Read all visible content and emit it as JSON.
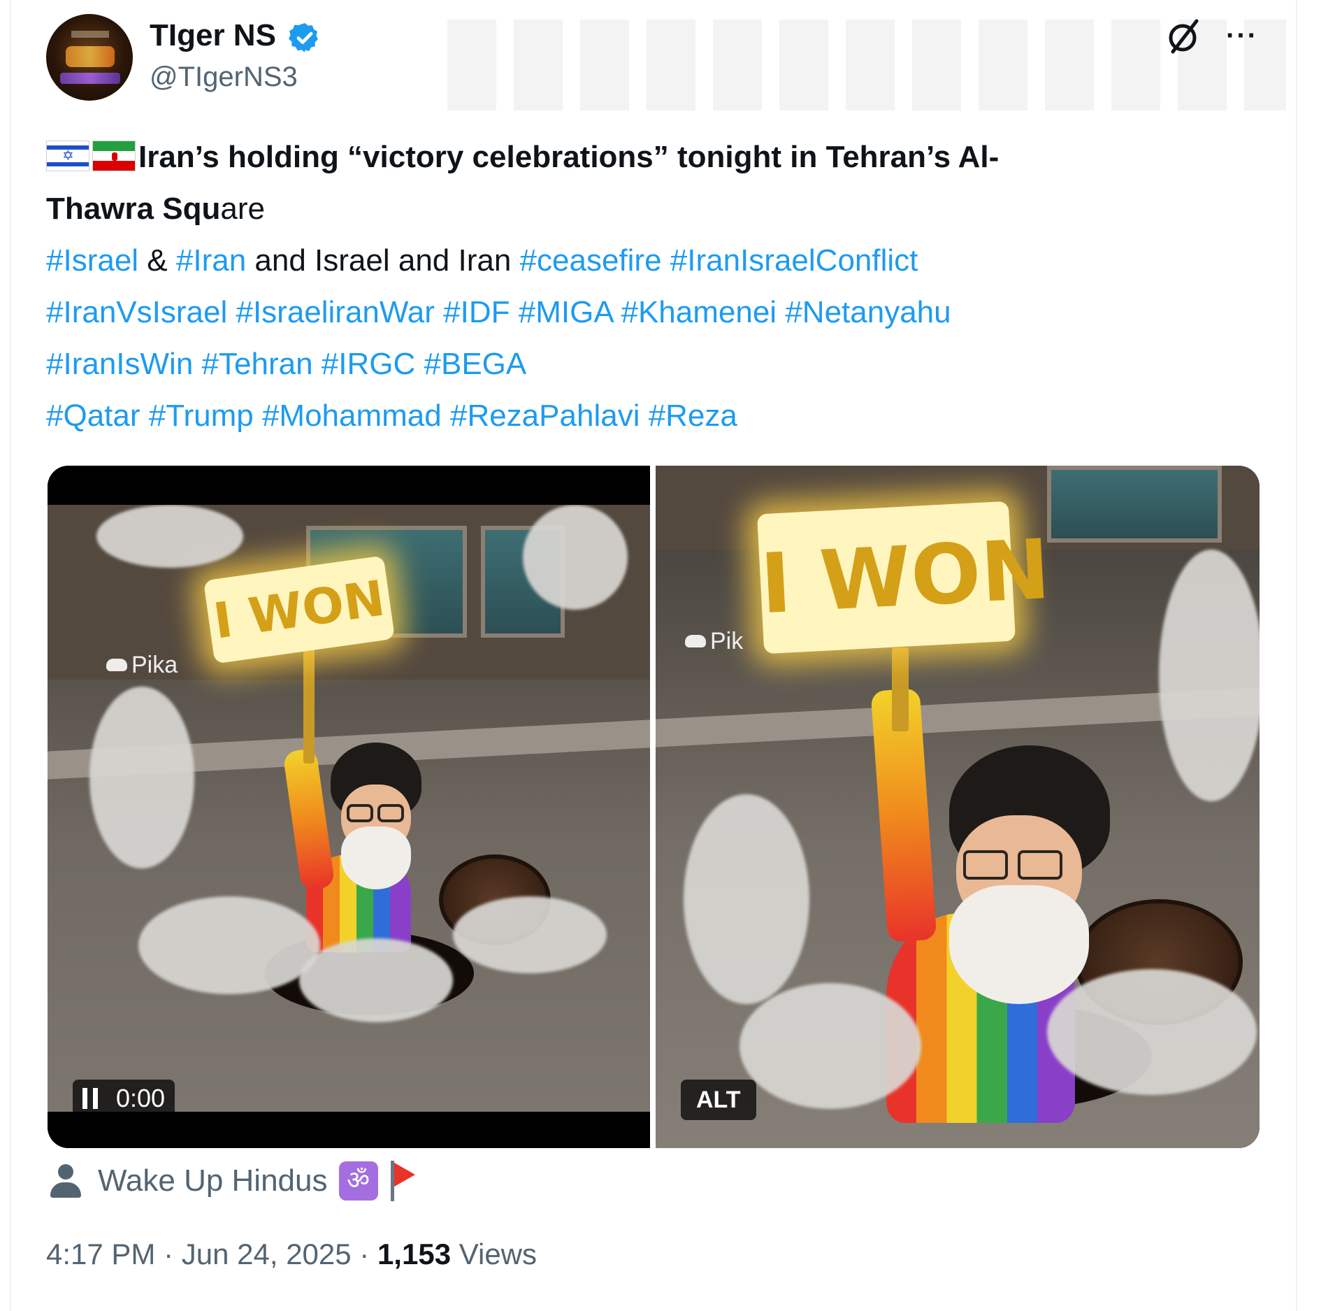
{
  "author": {
    "display_name": "TIger NS",
    "handle": "@TIgerNS3",
    "verified": true,
    "avatar_icon": "avatar-image"
  },
  "header_actions": {
    "grok_icon": "grok-icon",
    "more_icon": "more-icon",
    "more_label": "···"
  },
  "post": {
    "flags": [
      "🇮🇱",
      "🇮🇷"
    ],
    "line1_bold": "Iran’s holding “victory celebrations” tonight in Tehran’s Al-",
    "line2_bold": "Thawra Squ",
    "line2_rest": "are",
    "line3": {
      "tag1": "#Israel",
      "amp": " & ",
      "tag2": "#Iran",
      "plain": " and Israel and Iran ",
      "tag3": "#ceasefire",
      "tag4": "#IranIsraelConflict"
    },
    "line4": [
      "#IranVsIsrael",
      "#IsraeliranWar",
      "#IDF",
      "#MIGA",
      "#Khamenei",
      "#Netanyahu"
    ],
    "line5": [
      "#IranIsWin",
      "#Tehran",
      "#IRGC",
      "#BEGA"
    ],
    "line6": [
      "#Qatar",
      "#Trump",
      "#Mohammad",
      "#RezaPahlavi",
      "#Reza"
    ]
  },
  "media": {
    "left": {
      "type": "video",
      "sign_text": "I WON",
      "watermark": "Pika",
      "player": {
        "time": "0:00",
        "icon": "pause-icon"
      }
    },
    "right": {
      "type": "image",
      "sign_text": "I WON",
      "watermark": "Pik",
      "alt_label": "ALT"
    }
  },
  "tagged": {
    "icon": "person-icon",
    "name": "Wake Up Hindus",
    "emoji_icons": [
      "om-icon",
      "red-flag-icon"
    ],
    "om_glyph": "ॐ"
  },
  "meta": {
    "time": "4:17 PM",
    "date": "Jun 24, 2025",
    "separator": " · ",
    "views_count": "1,153",
    "views_label": " Views"
  },
  "colors": {
    "link": "#1d9bf0",
    "text": "#0f1419",
    "secondary": "#536471",
    "verified": "#1d9bf0"
  }
}
